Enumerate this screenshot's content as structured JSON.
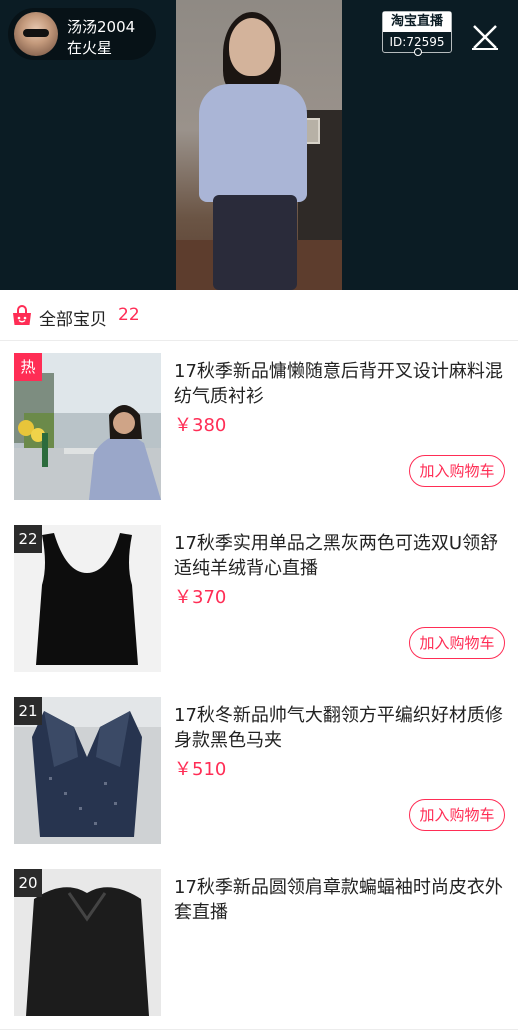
{
  "host": {
    "name": "汤汤2004",
    "status": "在火星"
  },
  "brand": {
    "logo_text": "淘宝直播",
    "live_id": "ID:72595"
  },
  "panel": {
    "title": "全部宝贝",
    "count": "22"
  },
  "products": [
    {
      "badge": "热",
      "title": "17秋季新品慵懒随意后背开叉设计麻料混纺气质衬衫",
      "price": "￥380",
      "cart_label": "加入购物车"
    },
    {
      "badge": "22",
      "title": "17秋季实用单品之黑灰两色可选双U领舒适纯羊绒背心直播",
      "price": "￥370",
      "cart_label": "加入购物车"
    },
    {
      "badge": "21",
      "title": "17秋冬新品帅气大翻领方平编织好材质修身款黑色马夹",
      "price": "￥510",
      "cart_label": "加入购物车"
    },
    {
      "badge": "20",
      "title": "17秋季新品圆领肩章款蝙蝠袖时尚皮衣外套直播",
      "price": "",
      "cart_label": ""
    }
  ],
  "colors": {
    "accent": "#ff2d55",
    "video_bg": "#0b1c24"
  },
  "icons": {
    "close": "close-icon",
    "bag": "shopping-bag-icon"
  }
}
